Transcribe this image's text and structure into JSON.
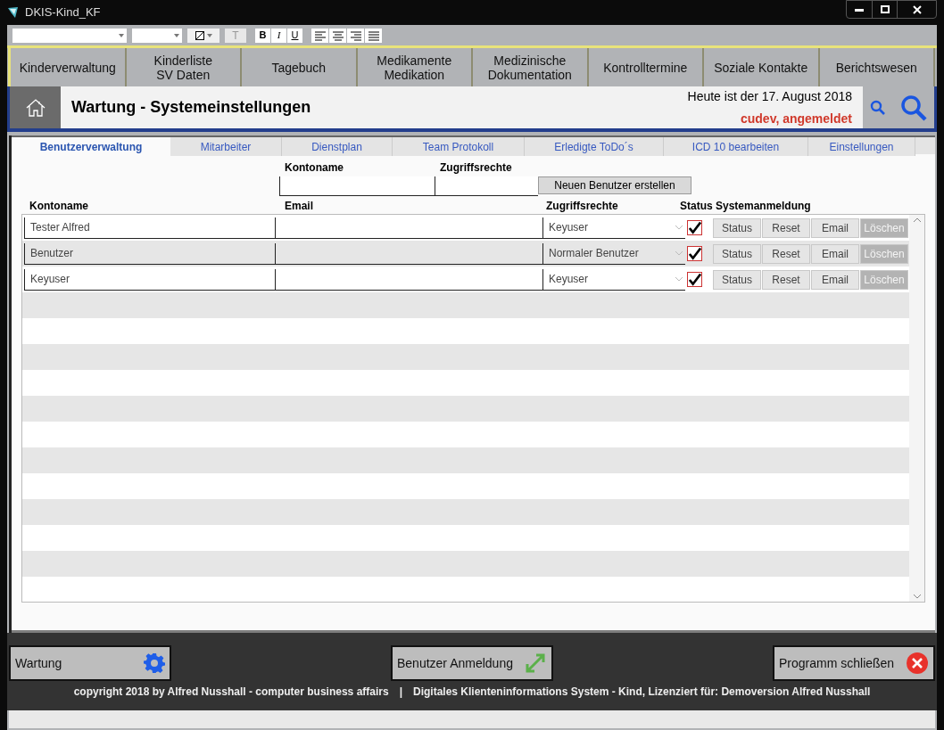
{
  "window": {
    "title": "DKIS-Kind_KF"
  },
  "toolbar": {
    "bold": "B",
    "italic": "I",
    "underline": "U",
    "text_tool": "T"
  },
  "nav": [
    {
      "label": "Kinderverwaltung"
    },
    {
      "label": "Kinderliste\nSV Daten"
    },
    {
      "label": "Tagebuch"
    },
    {
      "label": "Medikamente\nMedikation"
    },
    {
      "label": "Medizinische\nDokumentation"
    },
    {
      "label": "Kontrolltermine"
    },
    {
      "label": "Soziale Kontakte"
    },
    {
      "label": "Berichtswesen"
    }
  ],
  "header": {
    "title": "Wartung - Systemeinstellungen",
    "date": "Heute ist der 17. August 2018",
    "user": "cudev, angemeldet"
  },
  "tabs": [
    {
      "label": "Benutzerverwaltung",
      "selected": true
    },
    {
      "label": "Mitarbeiter",
      "selected": false
    },
    {
      "label": "Dienstplan",
      "selected": false
    },
    {
      "label": "Team Protokoll",
      "selected": false
    },
    {
      "label": "Erledigte ToDo´s",
      "selected": false
    },
    {
      "label": "ICD 10 bearbeiten",
      "selected": false
    },
    {
      "label": "Einstellungen",
      "selected": false
    }
  ],
  "new_user": {
    "account_label": "Kontoname",
    "rights_label": "Zugriffsrechte",
    "button": "Neuen Benutzer erstellen"
  },
  "table": {
    "columns": [
      "Kontoname",
      "Email",
      "Zugriffsrechte",
      "Status",
      "Systemanmeldung"
    ],
    "rows": [
      {
        "account": "Tester Alfred",
        "rights": "Keyuser",
        "checked": true,
        "actions": [
          {
            "label": "Status",
            "disabled": false
          },
          {
            "label": "Reset",
            "disabled": false
          },
          {
            "label": "Email",
            "disabled": false
          },
          {
            "label": "Löschen",
            "disabled": true
          }
        ]
      },
      {
        "account": "Benutzer",
        "rights": "Normaler Benutzer",
        "checked": true,
        "actions": [
          {
            "label": "Status",
            "disabled": false
          },
          {
            "label": "Reset",
            "disabled": false
          },
          {
            "label": "Email",
            "disabled": false
          },
          {
            "label": "Löschen",
            "disabled": true
          }
        ]
      },
      {
        "account": "Keyuser",
        "rights": "Keyuser",
        "checked": true,
        "actions": [
          {
            "label": "Status",
            "disabled": false
          },
          {
            "label": "Reset",
            "disabled": false
          },
          {
            "label": "Email",
            "disabled": false
          },
          {
            "label": "Löschen",
            "disabled": true
          }
        ]
      }
    ]
  },
  "footer": {
    "buttons": [
      {
        "label": "Wartung",
        "kind": "gear"
      },
      {
        "label": "Benutzer Anmeldung",
        "kind": "expand"
      },
      {
        "label": "Programm schließen",
        "kind": "close"
      }
    ],
    "copyright": "copyright 2018 by Alfred Nusshall - computer business affairs",
    "separator": "|",
    "license": "Digitales Klienteninformations System - Kind, Lizenziert für: Demoversion Alfred Nusshall"
  }
}
